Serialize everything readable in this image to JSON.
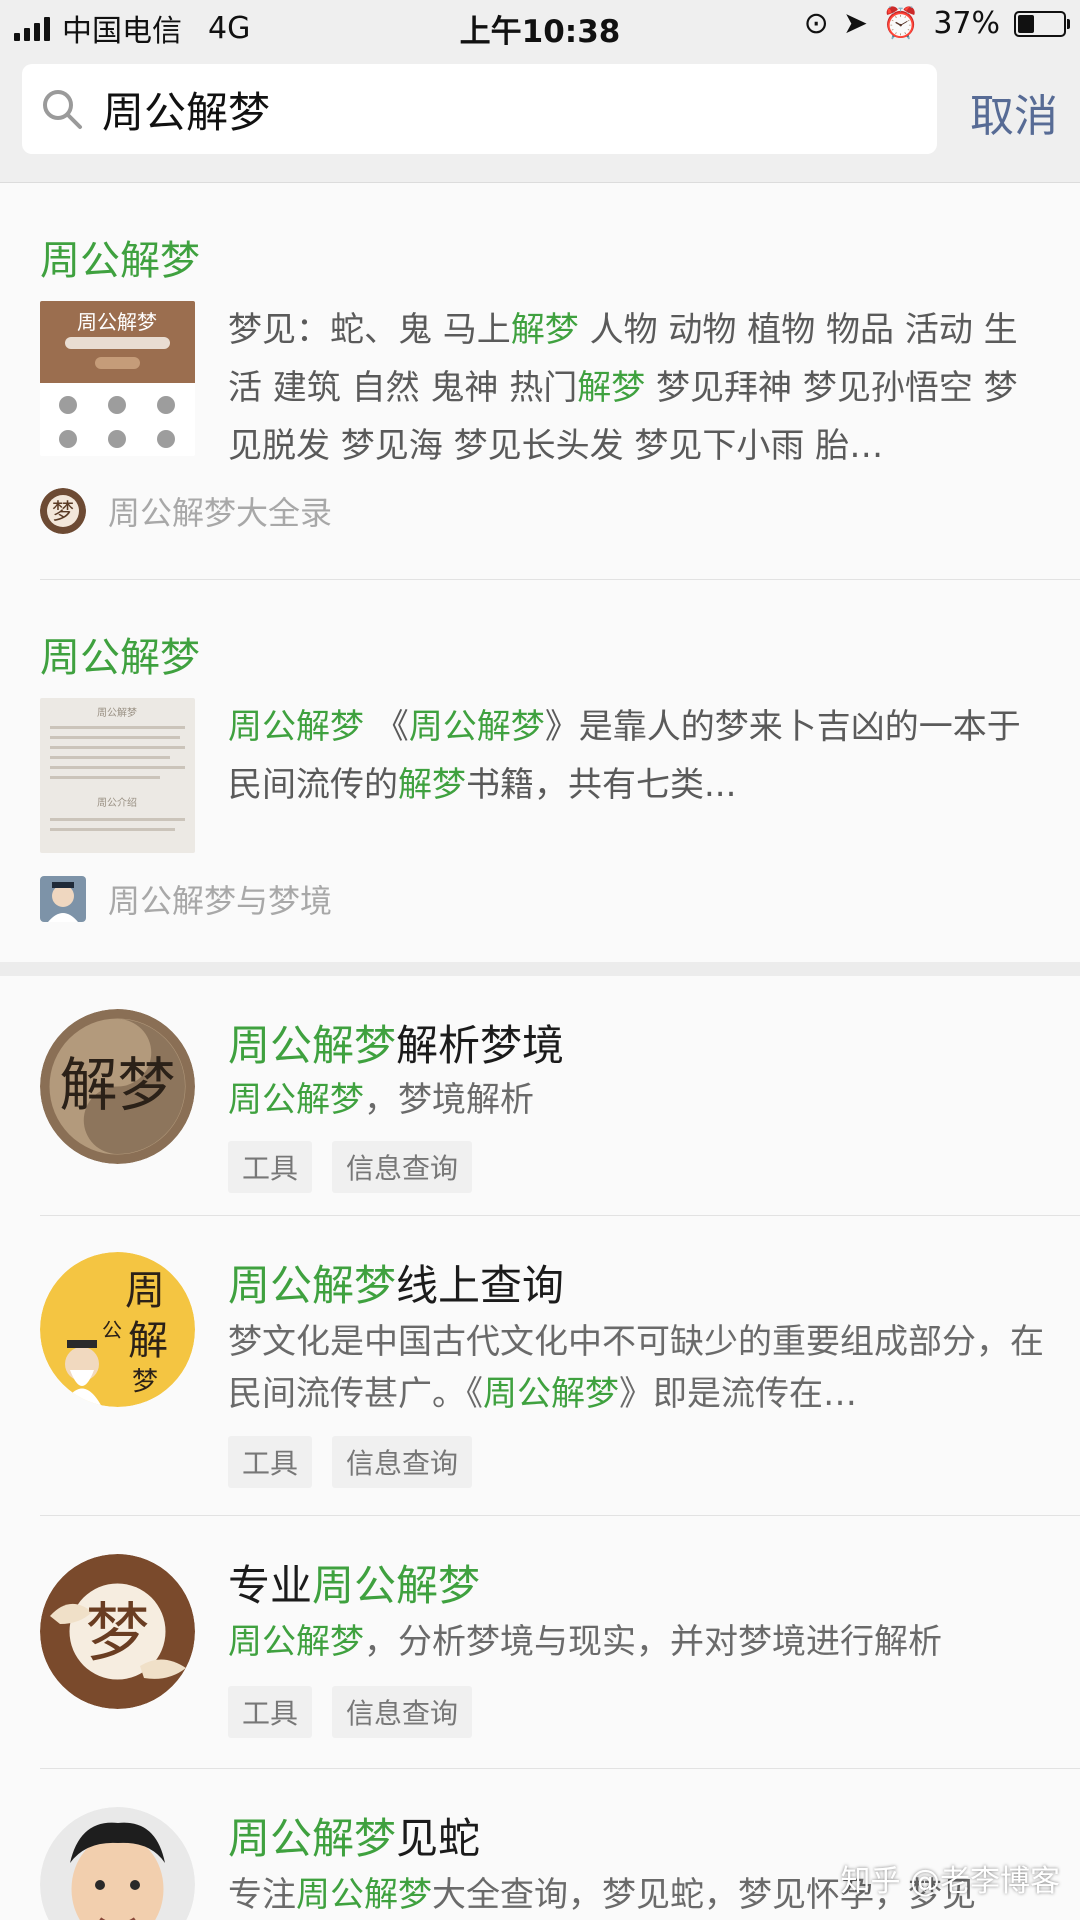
{
  "status_bar": {
    "carrier": "中国电信",
    "network": "4G",
    "time": "上午10:38",
    "battery": "37%",
    "battery_level": 0.37
  },
  "search": {
    "query": "周公解梦",
    "cancel_label": "取消"
  },
  "articles": [
    {
      "title": "周公解梦",
      "snippet": [
        {
          "t": "梦见：蛇、鬼 马上",
          "h": false
        },
        {
          "t": "解梦",
          "h": true
        },
        {
          "t": " 人物 动物 植物 物品 活动 生活 建筑 自然 鬼神 热门",
          "h": false
        },
        {
          "t": "解梦",
          "h": true
        },
        {
          "t": " 梦见拜神 梦见孙悟空 梦见脱发 梦见海 梦见长头发 梦见下小雨 胎…",
          "h": false
        }
      ],
      "source": "周公解梦大全录"
    },
    {
      "title": "周公解梦",
      "snippet": [
        {
          "t": "周公解梦",
          "h": true
        },
        {
          "t": " 《",
          "h": false
        },
        {
          "t": "周公解梦",
          "h": true
        },
        {
          "t": "》是靠人的梦来卜吉凶的一本于民间流传的",
          "h": false
        },
        {
          "t": "解梦",
          "h": true
        },
        {
          "t": "书籍，共有七类...",
          "h": false
        }
      ],
      "source": "周公解梦与梦境"
    }
  ],
  "apps": [
    {
      "name": [
        {
          "t": "周公解梦",
          "h": true
        },
        {
          "t": "解析梦境",
          "h": false
        }
      ],
      "desc": [
        {
          "t": "周公解梦",
          "h": true
        },
        {
          "t": "，梦境解析",
          "h": false
        }
      ],
      "tags": [
        "工具",
        "信息查询"
      ],
      "icon_text": "解梦"
    },
    {
      "name": [
        {
          "t": "周公解梦",
          "h": true
        },
        {
          "t": "线上查询",
          "h": false
        }
      ],
      "desc": [
        {
          "t": "梦文化是中国古代文化中不可缺少的重要组成部分，在民间流传甚广。《",
          "h": false
        },
        {
          "t": "周公解梦",
          "h": true
        },
        {
          "t": "》即是流传在…",
          "h": false
        }
      ],
      "tags": [
        "工具",
        "信息查询"
      ],
      "icon_text": "周公解梦"
    },
    {
      "name": [
        {
          "t": "专业",
          "h": false
        },
        {
          "t": "周公解梦",
          "h": true
        }
      ],
      "desc": [
        {
          "t": "周公解梦",
          "h": true
        },
        {
          "t": "，分析梦境与现实，并对梦境进行解析",
          "h": false
        }
      ],
      "tags": [
        "工具",
        "信息查询"
      ],
      "icon_text": "梦"
    },
    {
      "name": [
        {
          "t": "周公解梦",
          "h": true
        },
        {
          "t": "见蛇",
          "h": false
        }
      ],
      "desc": [
        {
          "t": "专注",
          "h": false
        },
        {
          "t": "周公解梦",
          "h": true
        },
        {
          "t": "大全查询，梦见蛇，梦见怀孕，梦见",
          "h": false
        }
      ],
      "tags": [],
      "icon_text": ""
    }
  ],
  "watermark": "知乎 @老李博客",
  "colors": {
    "highlight": "#3fa13f",
    "link": "#576b95"
  }
}
